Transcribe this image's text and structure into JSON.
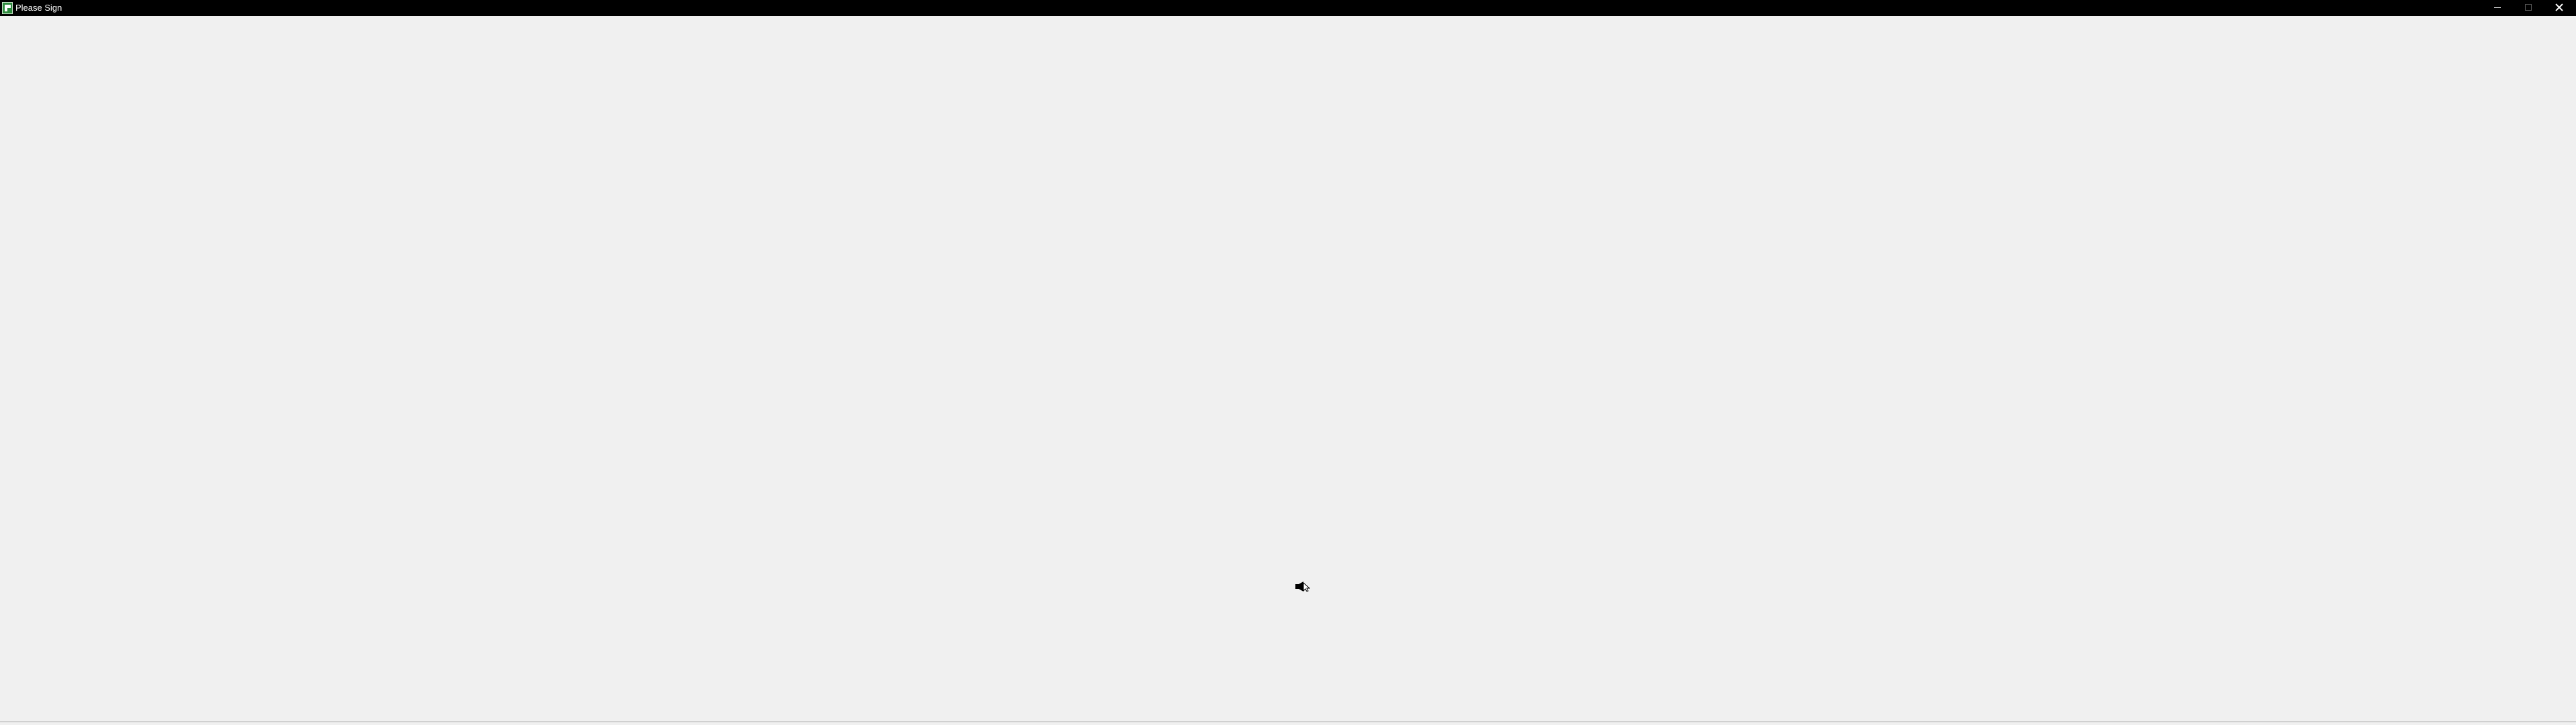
{
  "window": {
    "title": "Please Sign",
    "app_icon": "app-icon",
    "controls": {
      "minimize_icon": "minimize-icon",
      "maximize_icon": "maximize-icon",
      "close_icon": "close-icon"
    }
  },
  "content": {
    "background_color": "#f0f0f0",
    "cursor_icon": "mouse-cursor-icon"
  },
  "colors": {
    "titlebar": "#000000",
    "titlebar_text": "#ffffff",
    "background": "#f0f0f0"
  }
}
